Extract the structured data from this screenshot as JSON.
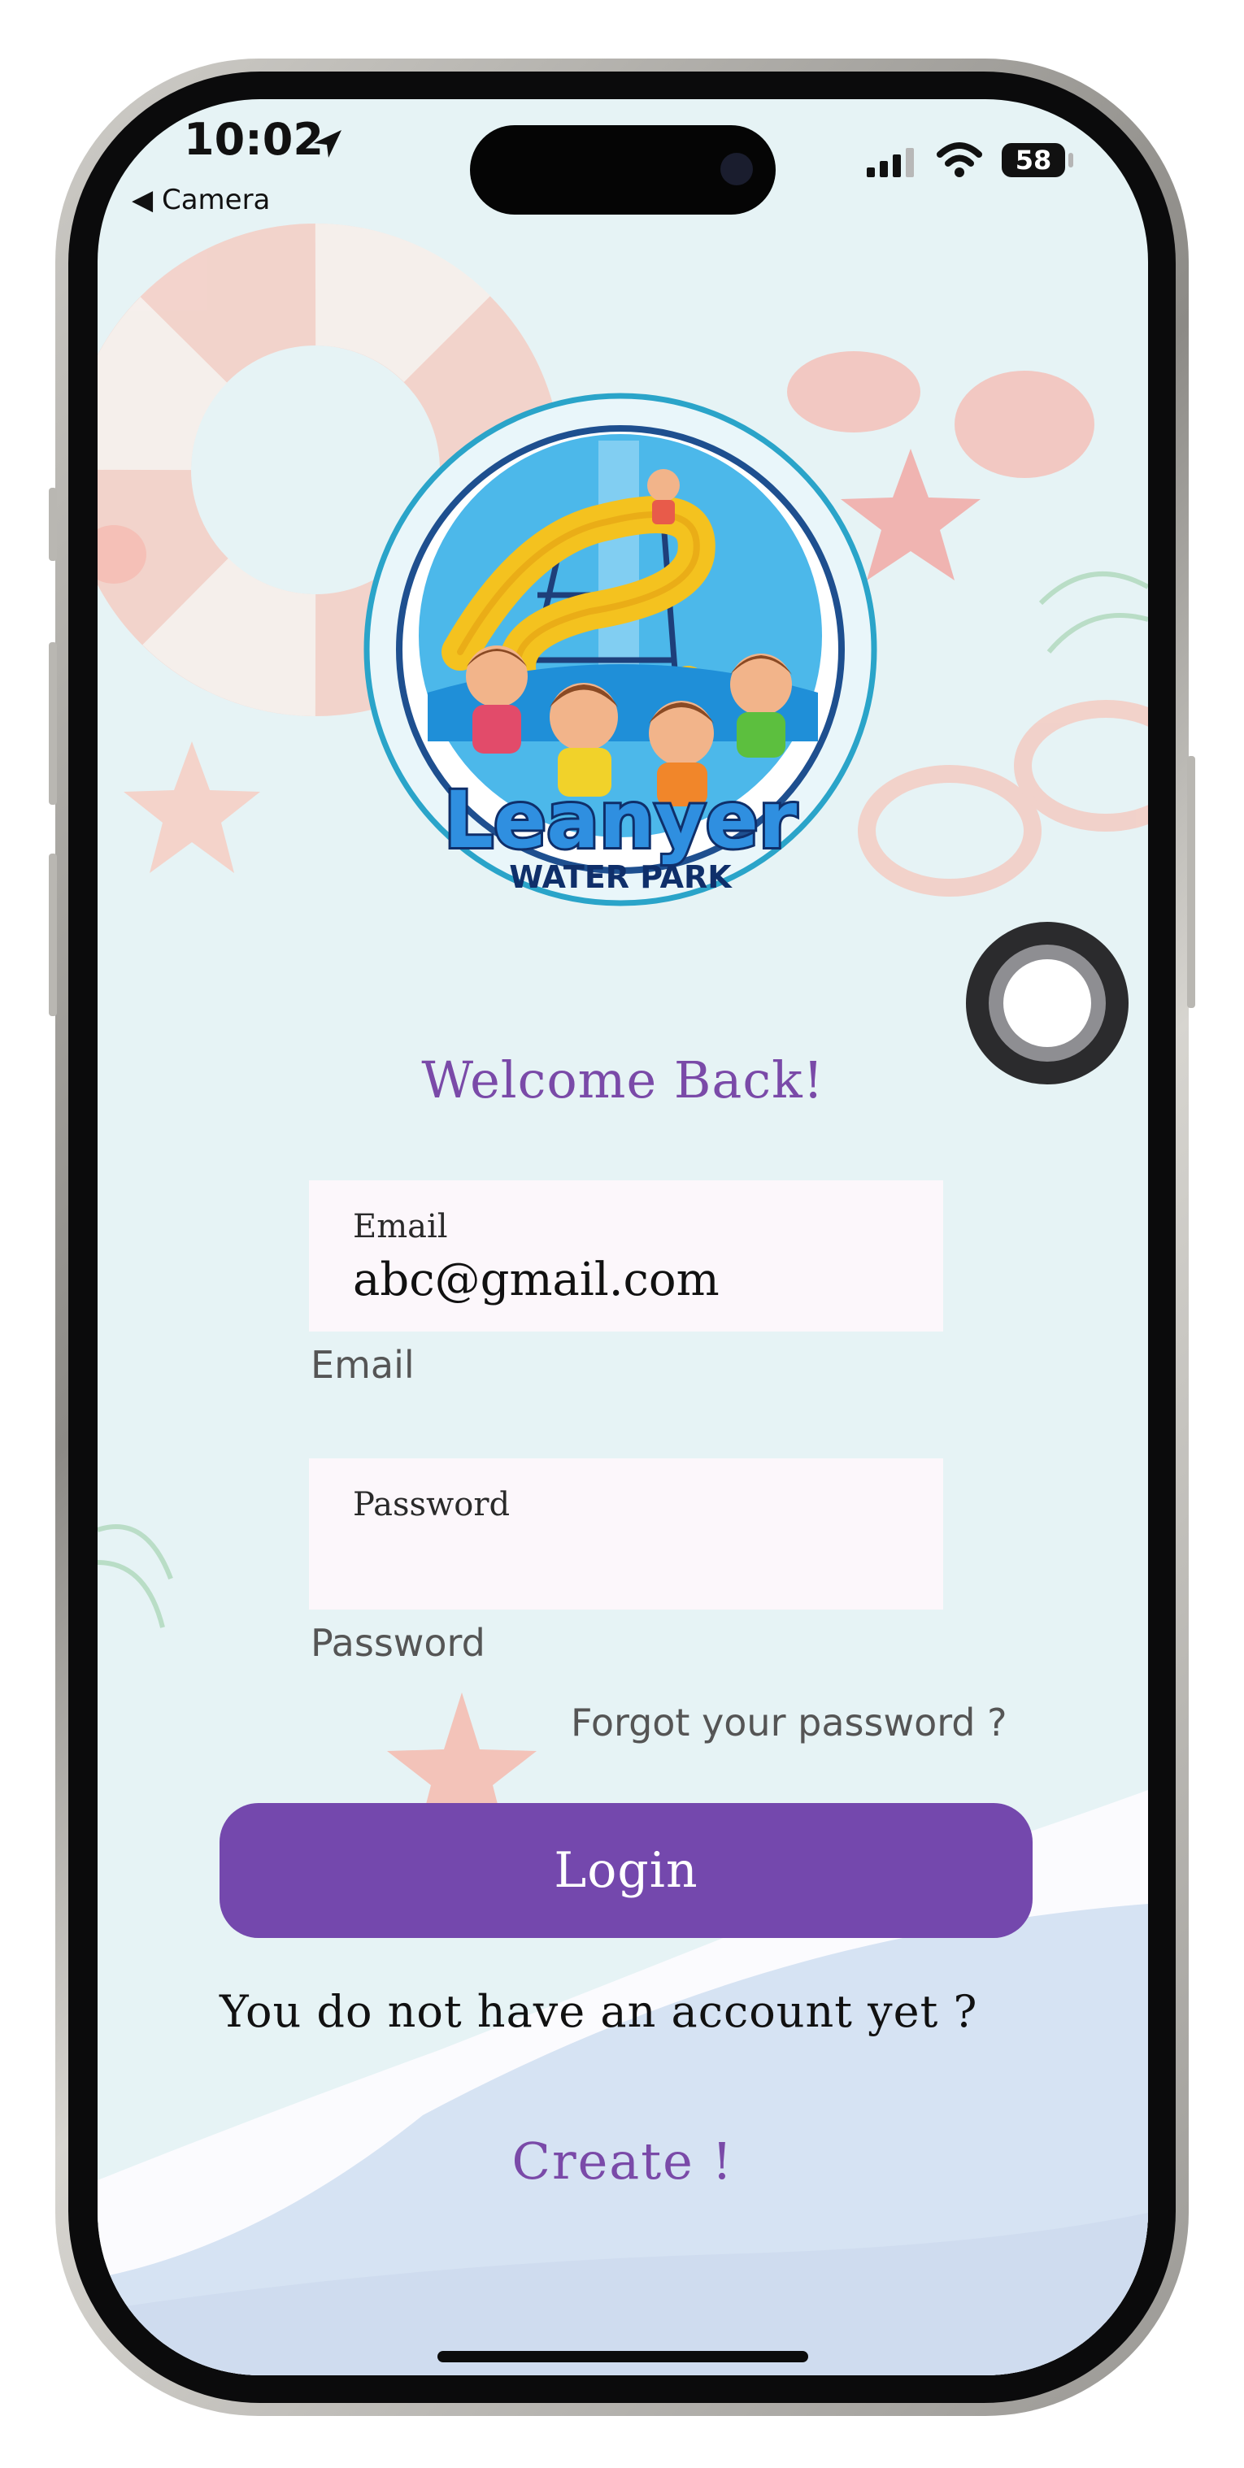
{
  "status_bar": {
    "time": "10:02",
    "back_app": "◀ Camera",
    "battery": "58"
  },
  "logo": {
    "brand_name": "Leanyer",
    "brand_sub": "WATER PARK"
  },
  "login": {
    "heading": "Welcome Back!",
    "email": {
      "floating_label": "Email",
      "value": "abc@gmail.com",
      "caption": "Email"
    },
    "password": {
      "floating_label": "Password",
      "value": "",
      "caption": "Password"
    },
    "forgot_link": "Forgot your password ?",
    "login_button": "Login",
    "no_account_text": "You do not have an account yet ?",
    "create_link": "Create !"
  },
  "colors": {
    "accent": "#7448ad",
    "heading": "#7a4aa8",
    "background": "#e6f3f5",
    "field_bg": "#fcf7fb"
  }
}
